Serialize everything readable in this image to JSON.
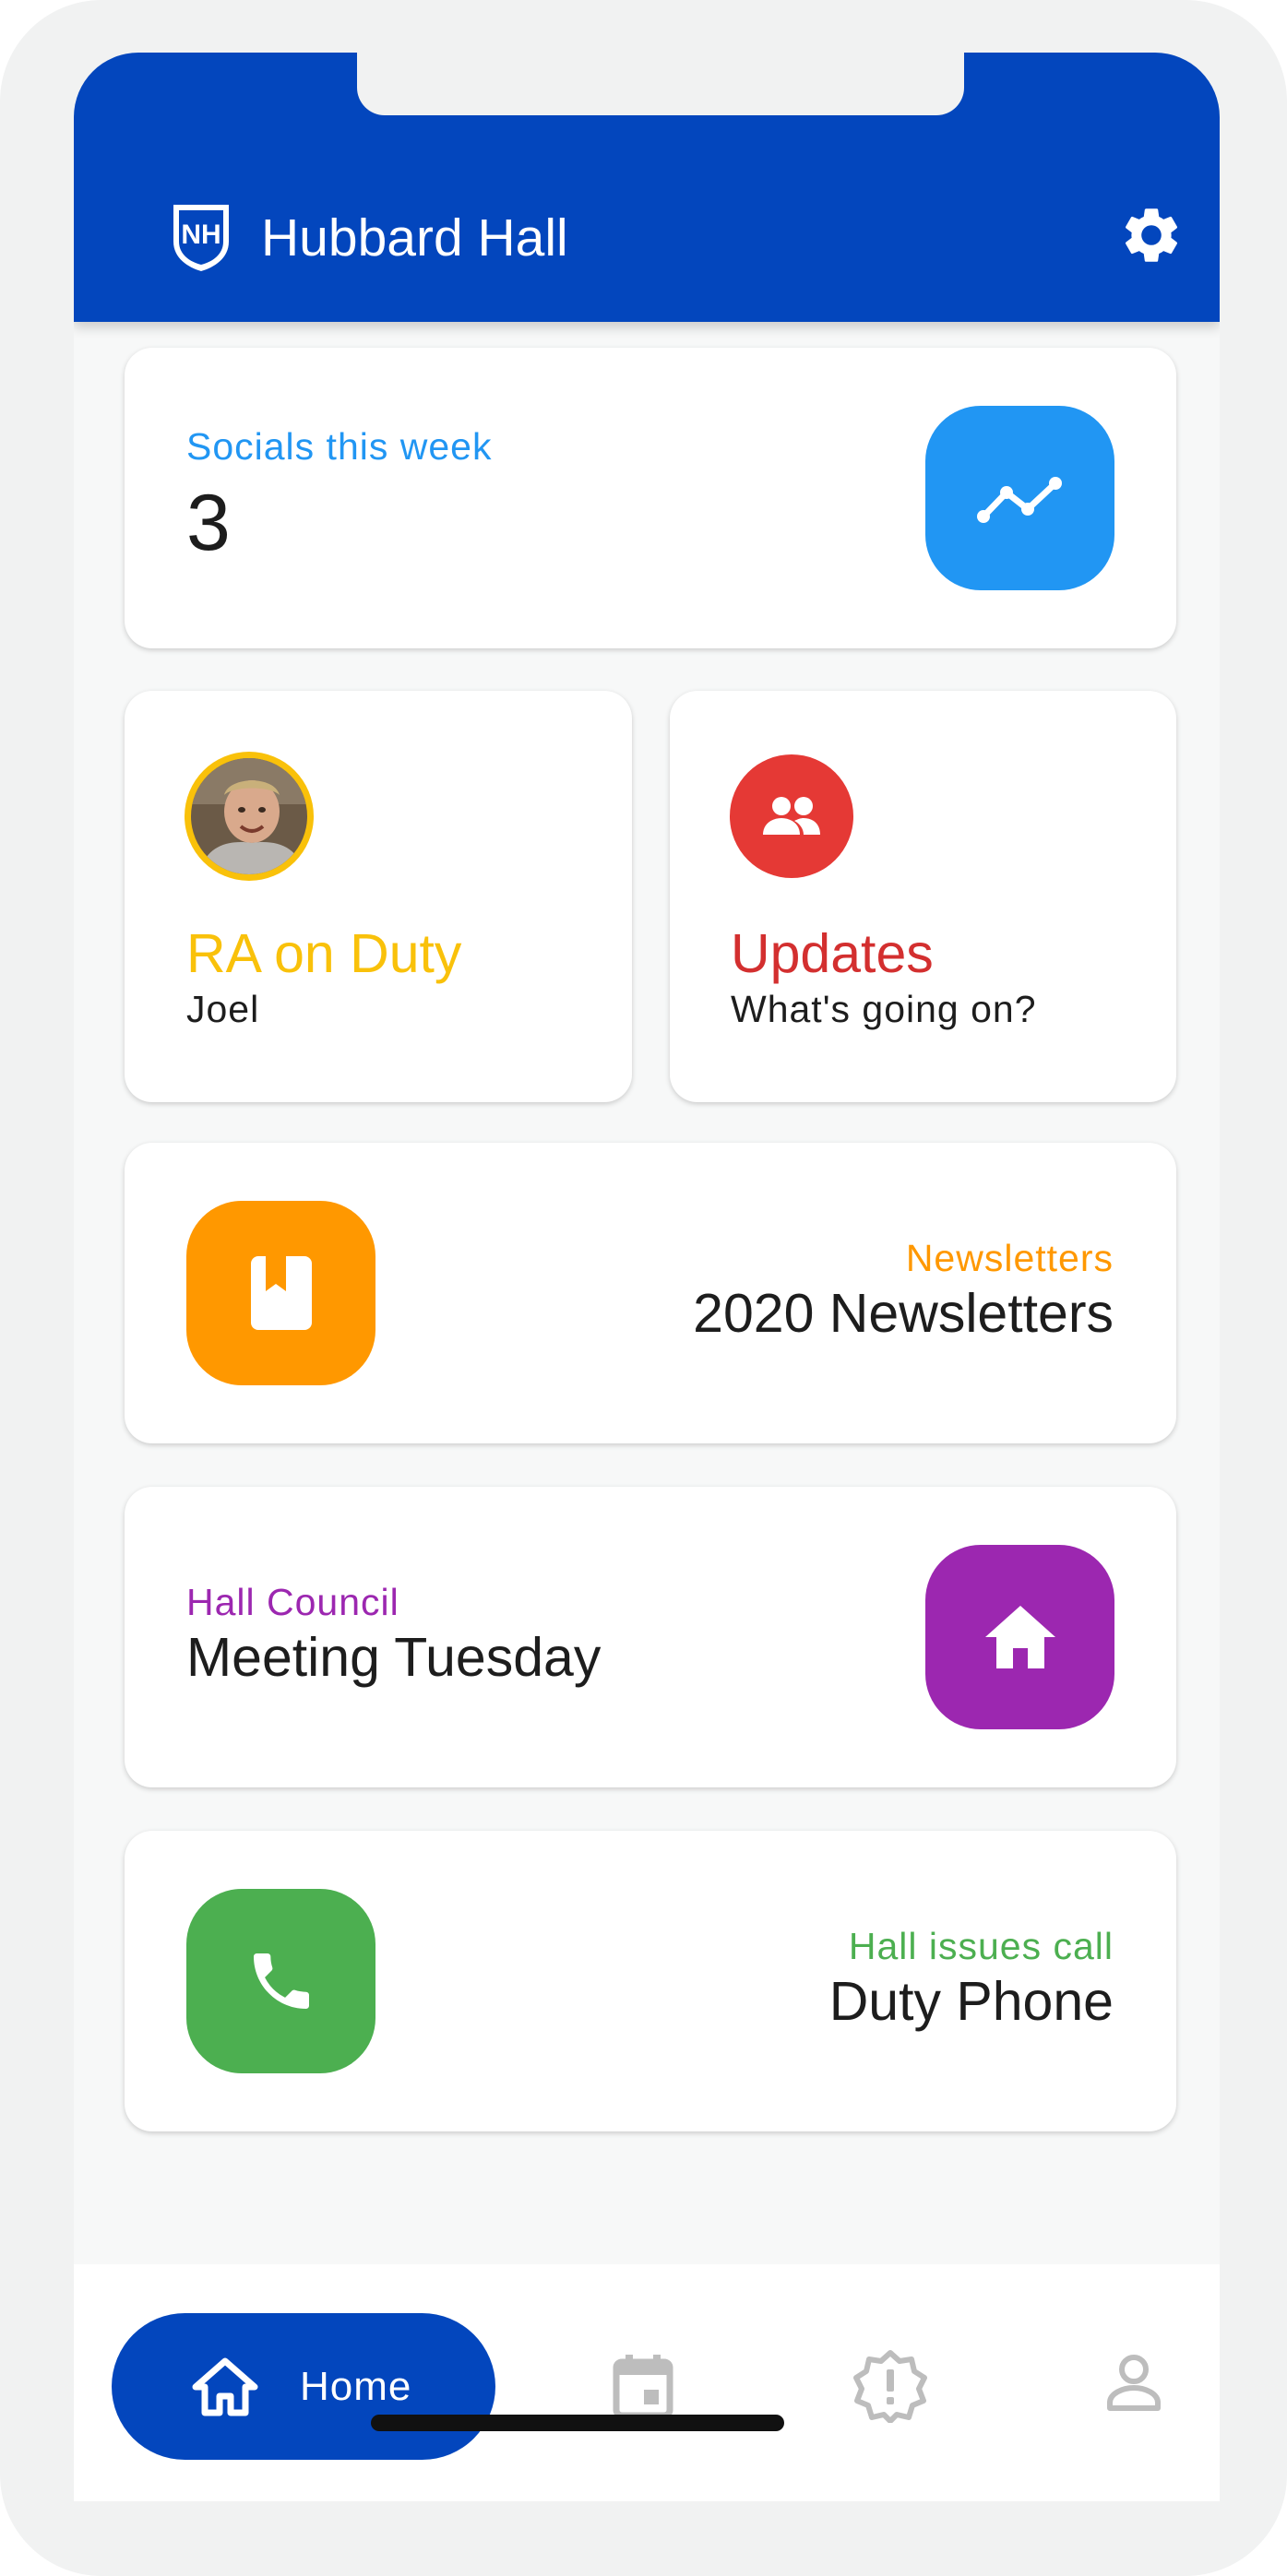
{
  "app": {
    "title": "Hubbard Hall",
    "brand_color": "#0346bd",
    "logo_icon": "unh-shield-logo",
    "settings_icon": "gear-icon"
  },
  "cards": {
    "socials": {
      "label": "Socials this week",
      "value": "3",
      "color": "#2196f3",
      "icon": "trending-line-icon"
    },
    "ra_on_duty": {
      "title": "RA on Duty",
      "name": "Joel",
      "color": "#f9c10a",
      "icon": "avatar"
    },
    "updates": {
      "title": "Updates",
      "subtitle": "What's going on?",
      "color": "#e53935",
      "icon": "people-icon"
    },
    "newsletters": {
      "label": "Newsletters",
      "value": "2020 Newsletters",
      "color": "#ff9800",
      "icon": "bookmark-book-icon"
    },
    "hall_council": {
      "label": "Hall Council",
      "value": "Meeting Tuesday",
      "color": "#9c27b0",
      "icon": "house-icon"
    },
    "duty_phone": {
      "label": "Hall issues call",
      "value": "Duty Phone",
      "color": "#4caf50",
      "icon": "phone-icon"
    }
  },
  "bottom_nav": {
    "items": [
      {
        "label": "Home",
        "icon": "home-icon",
        "active": true
      },
      {
        "label": "",
        "icon": "calendar-icon",
        "active": false
      },
      {
        "label": "",
        "icon": "alert-badge-icon",
        "active": false
      },
      {
        "label": "",
        "icon": "person-icon",
        "active": false
      }
    ]
  }
}
